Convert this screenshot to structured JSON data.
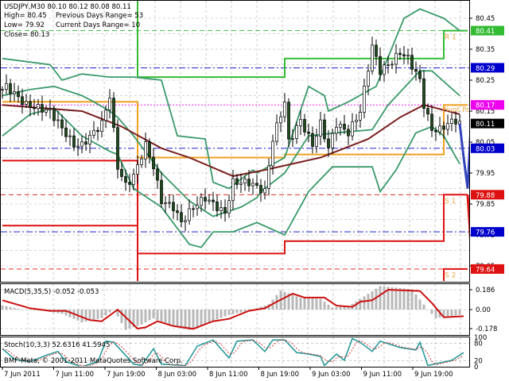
{
  "chart_data": {
    "type": "candlestick",
    "symbol_line": "USDJPY,M30  80.10 80.12 80.08 80.11",
    "info": {
      "high": "High= 80.45",
      "low": "Low= 79.92",
      "close": "Close= 80.13",
      "prev_range": "Previous Days Range= 53",
      "curr_range": "Current Days Range= 10"
    },
    "ylim": [
      79.63,
      80.51
    ],
    "y_ticks": [
      "80.45",
      "80.35",
      "80.25",
      "80.15",
      "80.05",
      "79.95",
      "79.85",
      "79.75",
      "79.65"
    ],
    "x_unit": "bar (M30)",
    "x_ticks": [
      "7 Jun 2011",
      "7 Jun 11:00",
      "7 Jun 19:00",
      "8 Jun 03:00",
      "8 Jun 11:00",
      "8 Jun 19:00",
      "9 Jun 03:00",
      "9 Jun 11:00",
      "9 Jun 19:00"
    ],
    "close_keypoints": [
      [
        0,
        80.22
      ],
      [
        1,
        80.23
      ],
      [
        6,
        80.17
      ],
      [
        12,
        80.15
      ],
      [
        18,
        80.04
      ],
      [
        20,
        80.04
      ],
      [
        25,
        80.11
      ],
      [
        27,
        80.2
      ],
      [
        29,
        79.97
      ],
      [
        31,
        79.91
      ],
      [
        33,
        79.94
      ],
      [
        36,
        80.04
      ],
      [
        38,
        79.97
      ],
      [
        40,
        79.86
      ],
      [
        43,
        79.84
      ],
      [
        45,
        79.79
      ],
      [
        48,
        79.84
      ],
      [
        51,
        79.87
      ],
      [
        54,
        79.84
      ],
      [
        56,
        79.82
      ],
      [
        58,
        79.92
      ],
      [
        62,
        79.92
      ],
      [
        66,
        79.89
      ],
      [
        68,
        80.06
      ],
      [
        71,
        80.18
      ],
      [
        72,
        80.05
      ],
      [
        75,
        80.12
      ],
      [
        78,
        80.04
      ],
      [
        80,
        80.11
      ],
      [
        82,
        80.03
      ],
      [
        84,
        80.11
      ],
      [
        87,
        80.08
      ],
      [
        90,
        80.15
      ],
      [
        93,
        80.36
      ],
      [
        95,
        80.28
      ],
      [
        98,
        80.31
      ],
      [
        100,
        80.34
      ],
      [
        102,
        80.32
      ],
      [
        105,
        80.25
      ],
      [
        106,
        80.17
      ],
      [
        108,
        80.09
      ],
      [
        110,
        80.09
      ],
      [
        112,
        80.11
      ],
      [
        114,
        80.12
      ],
      [
        115,
        80.11
      ]
    ],
    "moving_average": [
      [
        0,
        80.17
      ],
      [
        20,
        80.15
      ],
      [
        30,
        80.1
      ],
      [
        40,
        80.03
      ],
      [
        47,
        80.0
      ],
      [
        58,
        79.94
      ],
      [
        66,
        79.96
      ],
      [
        80,
        80.0
      ],
      [
        92,
        80.06
      ],
      [
        100,
        80.13
      ],
      [
        106,
        80.17
      ],
      [
        115,
        80.14
      ]
    ],
    "bollinger_upper": [
      [
        0,
        80.32
      ],
      [
        12,
        80.3
      ],
      [
        15,
        80.25
      ],
      [
        20,
        80.27
      ],
      [
        27,
        80.26
      ],
      [
        33,
        80.26
      ],
      [
        40,
        80.25
      ],
      [
        44,
        80.07
      ],
      [
        51,
        80.06
      ],
      [
        53,
        79.92
      ],
      [
        57,
        79.9
      ],
      [
        63,
        79.96
      ],
      [
        64,
        79.95
      ],
      [
        71,
        80.0
      ],
      [
        77,
        80.23
      ],
      [
        81,
        80.2
      ],
      [
        82,
        80.15
      ],
      [
        87,
        80.18
      ],
      [
        94,
        80.23
      ],
      [
        101,
        80.45
      ],
      [
        105,
        80.48
      ],
      [
        111,
        80.45
      ],
      [
        115,
        80.41
      ]
    ],
    "bollinger_middle": [
      [
        0,
        80.2
      ],
      [
        7,
        80.22
      ],
      [
        13,
        80.23
      ],
      [
        20,
        80.2
      ],
      [
        23,
        80.18
      ],
      [
        27,
        80.15
      ],
      [
        29,
        80.13
      ],
      [
        33,
        80.07
      ],
      [
        40,
        79.95
      ],
      [
        47,
        79.86
      ],
      [
        53,
        79.81
      ],
      [
        60,
        79.84
      ],
      [
        64,
        79.87
      ],
      [
        65,
        79.89
      ],
      [
        71,
        79.95
      ],
      [
        77,
        80.07
      ],
      [
        84,
        80.08
      ],
      [
        93,
        80.09
      ],
      [
        97,
        80.17
      ],
      [
        105,
        80.28
      ],
      [
        108,
        80.28
      ],
      [
        115,
        80.2
      ]
    ],
    "bollinger_lower": [
      [
        0,
        80.07
      ],
      [
        7,
        80.14
      ],
      [
        13,
        80.16
      ],
      [
        20,
        80.07
      ],
      [
        27,
        80.02
      ],
      [
        29,
        80.01
      ],
      [
        33,
        79.9
      ],
      [
        40,
        79.84
      ],
      [
        47,
        79.72
      ],
      [
        50,
        79.71
      ],
      [
        53,
        79.76
      ],
      [
        58,
        79.76
      ],
      [
        64,
        79.79
      ],
      [
        71,
        79.75
      ],
      [
        77,
        79.89
      ],
      [
        83,
        79.97
      ],
      [
        93,
        79.97
      ],
      [
        95,
        79.89
      ],
      [
        99,
        79.96
      ],
      [
        104,
        80.08
      ],
      [
        108,
        80.1
      ],
      [
        111,
        80.07
      ],
      [
        115,
        79.98
      ]
    ],
    "day_boundaries": [
      0,
      34,
      71,
      111,
      117
    ],
    "pivots": {
      "R1": {
        "label": "R 1",
        "values": [
          80.55,
          80.26,
          80.32,
          80.41
        ],
        "color": "#33bb33"
      },
      "Pivot": {
        "label": "Pivot Po",
        "values": [
          80.18,
          80.0,
          80.01,
          80.17
        ],
        "color": "#f0a020"
      },
      "S1": {
        "label": "S 1",
        "values": [
          79.99,
          79.69,
          79.73,
          79.88
        ],
        "color": "#dd1111"
      },
      "S2": {
        "label": "S 2",
        "values": [
          79.78,
          79.55,
          79.55,
          79.64
        ],
        "color": "#dd1111"
      }
    },
    "projection_blue": [
      [
        115,
        80.11
      ],
      [
        116,
        80.0
      ],
      [
        117,
        79.9
      ],
      [
        118,
        80.15
      ],
      [
        119,
        80.52
      ]
    ],
    "projection_red": [
      [
        117,
        79.88
      ],
      [
        117.5,
        79.78
      ],
      [
        118,
        79.66
      ]
    ],
    "levels": [
      {
        "value": 80.41,
        "label": "80.41",
        "color": "#33bb33",
        "style": "dash"
      },
      {
        "value": 80.29,
        "label": "80.29",
        "color": "#0000cc",
        "style": "dashdot"
      },
      {
        "value": 80.17,
        "label": "80.17",
        "color": "#ee00ee",
        "style": "dot"
      },
      {
        "value": 80.11,
        "label": "80.11",
        "color": "#000000",
        "style": "none"
      },
      {
        "value": 80.03,
        "label": "80.03",
        "color": "#0000cc",
        "style": "dashdot"
      },
      {
        "value": 79.88,
        "label": "79.88",
        "color": "#dd1111",
        "style": "dash"
      },
      {
        "value": 79.76,
        "label": "79.76",
        "color": "#0000cc",
        "style": "dashdot"
      },
      {
        "value": 79.64,
        "label": "79.64",
        "color": "#dd1111",
        "style": "dash"
      }
    ],
    "macd": {
      "title": "MACD(5,35,5) -0.052 -0.053",
      "y_ticks": [
        "0.186",
        "0.00",
        "-0.178"
      ],
      "ylim": [
        -0.2,
        0.23
      ],
      "histogram": [
        [
          0,
          0.04
        ],
        [
          5,
          0.0
        ],
        [
          10,
          -0.01
        ],
        [
          15,
          -0.04
        ],
        [
          20,
          -0.12
        ],
        [
          25,
          -0.08
        ],
        [
          28,
          0.0
        ],
        [
          31,
          -0.19
        ],
        [
          35,
          -0.14
        ],
        [
          38,
          -0.08
        ],
        [
          42,
          -0.15
        ],
        [
          47,
          -0.19
        ],
        [
          52,
          -0.12
        ],
        [
          57,
          -0.05
        ],
        [
          62,
          -0.01
        ],
        [
          67,
          0.05
        ],
        [
          70,
          0.18
        ],
        [
          75,
          0.11
        ],
        [
          80,
          0.1
        ],
        [
          83,
          0.02
        ],
        [
          87,
          0.03
        ],
        [
          90,
          0.1
        ],
        [
          95,
          0.22
        ],
        [
          103,
          0.19
        ],
        [
          107,
          0.0
        ],
        [
          109,
          -0.08
        ],
        [
          115,
          -0.05
        ]
      ],
      "signal": [
        [
          0,
          0.087
        ],
        [
          7,
          0.012
        ],
        [
          12,
          -0.012
        ],
        [
          16,
          -0.012
        ],
        [
          22,
          -0.099
        ],
        [
          25,
          -0.109
        ],
        [
          29,
          0.0
        ],
        [
          34,
          -0.178
        ],
        [
          36,
          -0.166
        ],
        [
          39,
          -0.109
        ],
        [
          43,
          -0.154
        ],
        [
          48,
          -0.18
        ],
        [
          53,
          -0.109
        ],
        [
          57,
          -0.087
        ],
        [
          62,
          -0.012
        ],
        [
          66,
          0.012
        ],
        [
          69,
          0.074
        ],
        [
          73,
          0.149
        ],
        [
          76,
          0.112
        ],
        [
          81,
          0.112
        ],
        [
          84,
          0.037
        ],
        [
          88,
          0.025
        ],
        [
          90,
          0.074
        ],
        [
          93,
          0.087
        ],
        [
          97,
          0.186
        ],
        [
          105,
          0.174
        ],
        [
          108,
          0.062
        ],
        [
          111,
          -0.072
        ],
        [
          116,
          -0.062
        ]
      ]
    },
    "stoch": {
      "title": "Stoch(10,3,3) 52.6316 41.5945",
      "y_ticks": [
        "100",
        "80",
        "20",
        "0"
      ],
      "ylim": [
        0,
        100
      ],
      "main": [
        [
          0,
          61
        ],
        [
          3,
          26
        ],
        [
          7,
          17
        ],
        [
          11,
          39
        ],
        [
          14,
          52
        ],
        [
          16,
          17
        ],
        [
          20,
          0
        ],
        [
          24,
          17
        ],
        [
          26,
          87
        ],
        [
          28,
          83
        ],
        [
          33,
          9
        ],
        [
          35,
          4
        ],
        [
          38,
          61
        ],
        [
          40,
          9
        ],
        [
          46,
          4
        ],
        [
          49,
          70
        ],
        [
          53,
          91
        ],
        [
          57,
          30
        ],
        [
          59,
          87
        ],
        [
          63,
          91
        ],
        [
          66,
          52
        ],
        [
          68,
          91
        ],
        [
          71,
          91
        ],
        [
          74,
          48
        ],
        [
          77,
          43
        ],
        [
          80,
          35
        ],
        [
          81,
          4
        ],
        [
          84,
          43
        ],
        [
          86,
          22
        ],
        [
          88,
          96
        ],
        [
          90,
          83
        ],
        [
          93,
          52
        ],
        [
          95,
          87
        ],
        [
          100,
          65
        ],
        [
          104,
          57
        ],
        [
          105,
          83
        ],
        [
          107,
          4
        ],
        [
          113,
          22
        ],
        [
          116,
          48
        ]
      ]
    },
    "copyright": "BMF-Meta, © 2001-2011 MetaQuotes Software Corp."
  }
}
